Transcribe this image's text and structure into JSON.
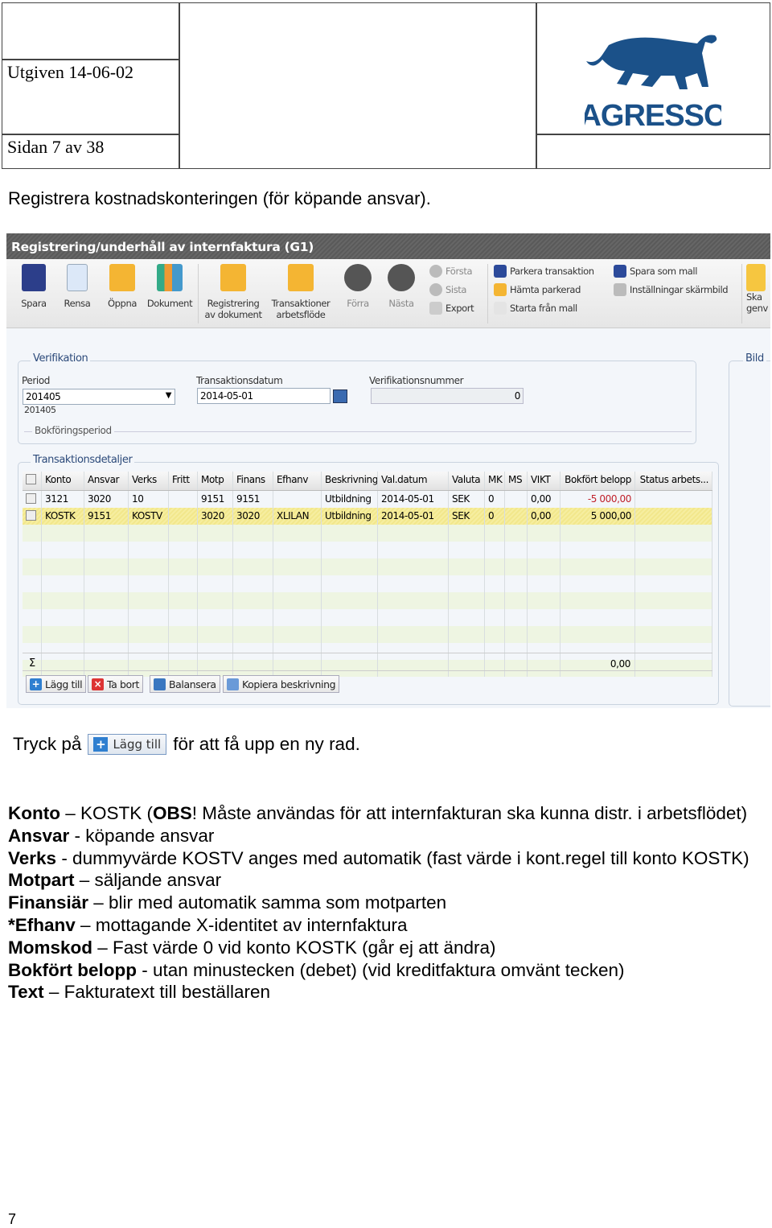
{
  "header": {
    "issued": "Utgiven 14-06-02",
    "page": "Sidan 7 av 38",
    "logo_text": "AGRESSO"
  },
  "intro": "Registrera kostnadskonteringen (för köpande ansvar).",
  "app": {
    "title": "Registrering/underhåll av internfaktura (G1)",
    "toolbar": {
      "save": "Spara",
      "clear": "Rensa",
      "open": "Öppna",
      "document": "Dokument",
      "reg_doc": [
        "Registrering",
        "av dokument"
      ],
      "trans_flow": [
        "Transaktioner",
        "arbetsflöde"
      ],
      "prev": "Förra",
      "next": "Nästa",
      "first": "Första",
      "last": "Sista",
      "export": "Export",
      "park": "Parkera transaktion",
      "fetch_parked": "Hämta parkerad",
      "start_template": "Starta från mall",
      "save_template": "Spara som mall",
      "screen_settings": "Inställningar skärmbild",
      "shortcut": [
        "Ska",
        "genv"
      ]
    },
    "verification": {
      "legend": "Verifikation",
      "period_label": "Period",
      "period_value": "201405",
      "period_sub": "201405",
      "date_label": "Transaktionsdatum",
      "date_value": "2014-05-01",
      "vernum_label": "Verifikationsnummer",
      "vernum_value": "0",
      "booking_legend": "Bokföringsperiod"
    },
    "bild_legend": "Bild",
    "details": {
      "legend": "Transaktionsdetaljer",
      "columns": [
        "Konto",
        "Ansvar",
        "Verks",
        "Fritt",
        "Motp",
        "Finans",
        "Efhanv",
        "Beskrivning",
        "Val.datum",
        "Valuta",
        "MK",
        "MS",
        "VIKT",
        "Bokfört belopp",
        "Status arbets..."
      ],
      "rows": [
        [
          "3121",
          "3020",
          "10",
          "",
          "9151",
          "9151",
          "",
          "Utbildning",
          "2014-05-01",
          "SEK",
          "0",
          "",
          "0,00",
          "-5 000,00",
          ""
        ],
        [
          "KOSTK",
          "9151",
          "KOSTV",
          "",
          "3020",
          "3020",
          "XLILAN",
          "Utbildning",
          "2014-05-01",
          "SEK",
          "0",
          "",
          "0,00",
          "5 000,00",
          ""
        ]
      ],
      "sum_symbol": "Σ",
      "sum_value": "0,00",
      "negative_color": "#c0202a",
      "selected_color": "#f4ec98"
    },
    "buttons": {
      "add": "Lägg till",
      "delete": "Ta bort",
      "balance": "Balansera",
      "copy_desc": "Kopiera beskrivning"
    }
  },
  "instruction": {
    "before": "Tryck på",
    "button": "Lägg till",
    "after": "för att få upp en ny rad."
  },
  "fields": [
    {
      "term": "Konto",
      "rest_pre": " – KOSTK (",
      "bold2": "OBS",
      "rest": "! Måste användas för att internfakturan ska kunna distr. i arbetsflödet)"
    },
    {
      "term": "Ansvar",
      "rest": " - köpande ansvar"
    },
    {
      "term": "Verks",
      "rest": " - dummyvärde KOSTV anges med automatik (fast värde i kont.regel till konto KOSTK)"
    },
    {
      "term": "Motpart",
      "rest": " – säljande ansvar"
    },
    {
      "term": "Finansiär",
      "rest": " – blir med automatik samma som motparten"
    },
    {
      "term": "*Efhanv",
      "rest": " – mottagande X-identitet av internfaktura"
    },
    {
      "term": "Momskod",
      "rest": " – Fast värde 0 vid konto KOSTK (går ej att ändra)"
    },
    {
      "term": "Bokfört belopp",
      "rest": " - utan minustecken (debet) (vid kreditfaktura omvänt tecken)"
    },
    {
      "term": "Text",
      "rest": " – Fakturatext till beställaren"
    }
  ],
  "footer_page": "7",
  "brand_color": "#1b5189"
}
